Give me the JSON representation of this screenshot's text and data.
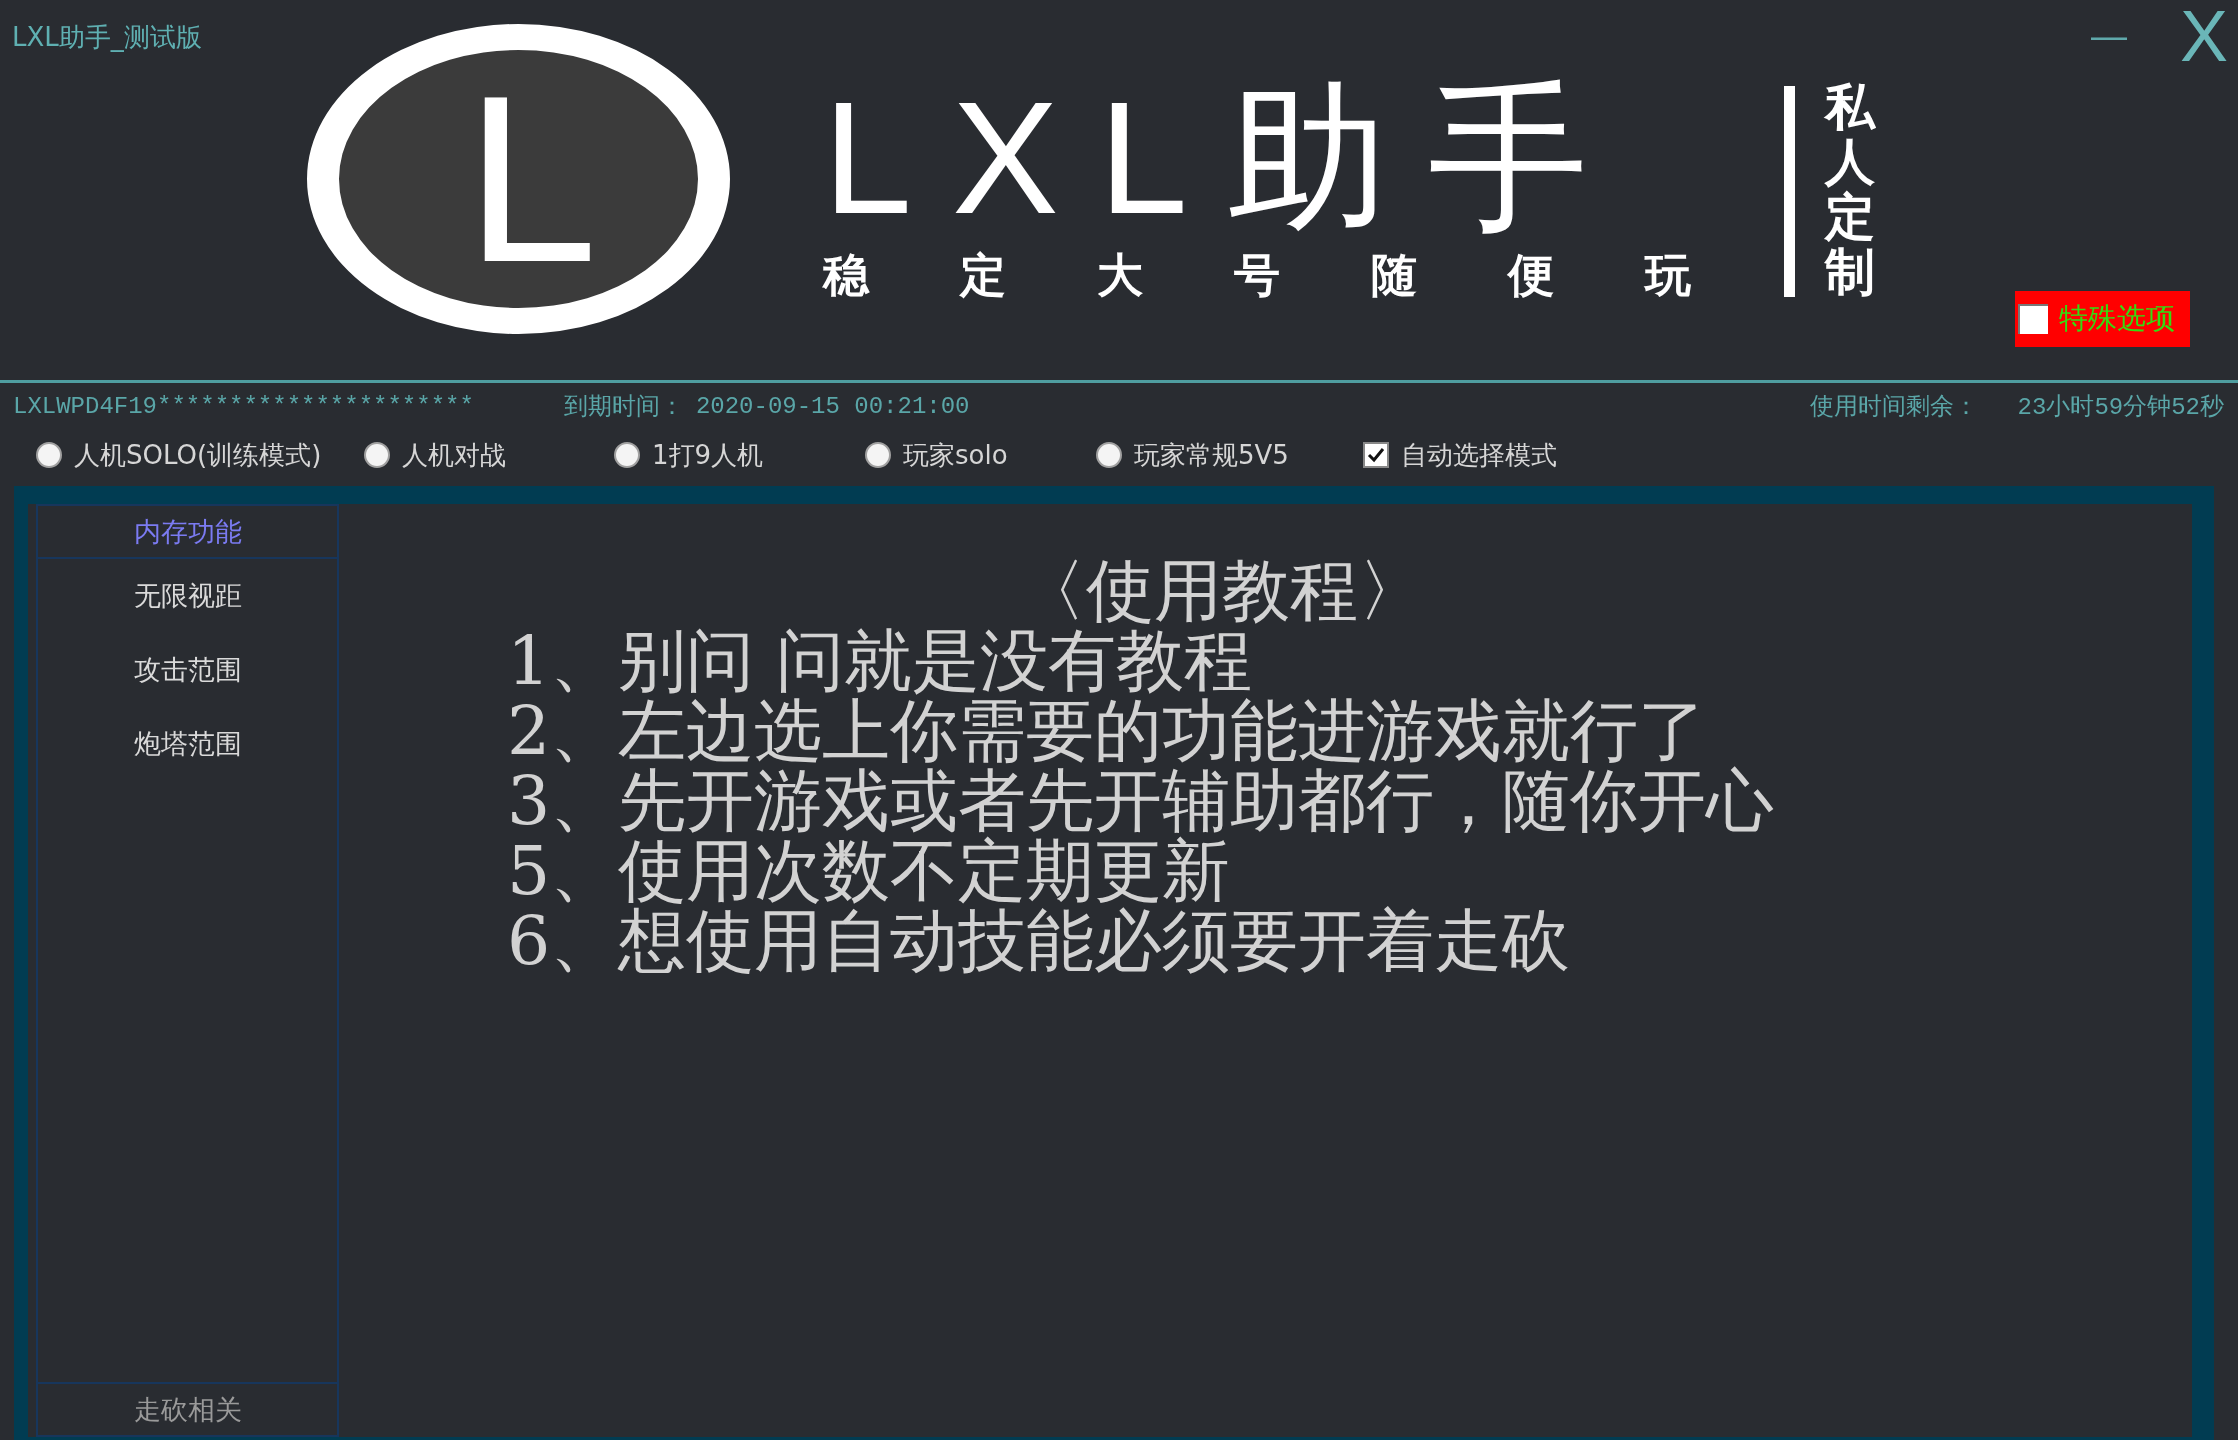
{
  "window": {
    "title": "LXL助手_测试版",
    "minimize_glyph": "—",
    "close_glyph": "X"
  },
  "header": {
    "logo_letter": "L",
    "brand": "LXL助手",
    "slogan": "稳 定 大 号 随 便 玩",
    "tagline": "私人定制",
    "special_option": {
      "label": "特殊选项",
      "checked": false
    }
  },
  "info_bar": {
    "license_key": "LXLWPD4F19**********************",
    "expiry_label": "到期时间：",
    "expiry_value": "2020-09-15 00:21:00",
    "remaining_label": "使用时间剩余：",
    "remaining_value": "23小时59分钟52秒"
  },
  "game_modes": [
    {
      "label": "人机SOLO(训练模式)",
      "selected": false
    },
    {
      "label": "人机对战",
      "selected": false
    },
    {
      "label": "1打9人机",
      "selected": false
    },
    {
      "label": "玩家solo",
      "selected": false
    },
    {
      "label": "玩家常规5V5",
      "selected": false
    }
  ],
  "auto_select": {
    "label": "自动选择模式",
    "checked": true
  },
  "sidebar": {
    "groups": [
      {
        "label": "内存功能",
        "expanded": true,
        "items": [
          "无限视距",
          "攻击范围",
          "炮塔范围"
        ]
      },
      {
        "label": "走砍相关",
        "expanded": false
      }
    ]
  },
  "tutorial": {
    "title": "〈使用教程〉",
    "lines": [
      "1、别问 问就是没有教程",
      "2、左边选上你需要的功能进游戏就行了",
      "3、先开游戏或者先开辅助都行，随你开心",
      "5、使用次数不定期更新",
      "6、想使用自动技能必须要开着走砍"
    ]
  }
}
